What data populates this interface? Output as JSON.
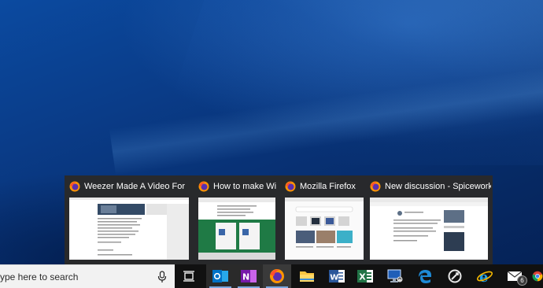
{
  "taskbar": {
    "search_placeholder": "ype here to search",
    "apps": [
      {
        "name": "task-view",
        "icon": "task-view-icon"
      },
      {
        "name": "outlook",
        "icon": "outlook-icon",
        "active": true
      },
      {
        "name": "onenote",
        "icon": "onenote-icon",
        "active": true
      },
      {
        "name": "firefox",
        "icon": "firefox-icon",
        "active": true,
        "hover": true
      },
      {
        "name": "file-explorer",
        "icon": "folder-icon"
      },
      {
        "name": "word",
        "icon": "word-icon"
      },
      {
        "name": "excel",
        "icon": "excel-icon"
      },
      {
        "name": "remote-desktop",
        "icon": "remote-desktop-icon"
      },
      {
        "name": "edge",
        "icon": "edge-icon"
      },
      {
        "name": "app-circle",
        "icon": "circular-arrow-icon"
      },
      {
        "name": "internet-explorer",
        "icon": "ie-icon"
      },
      {
        "name": "mail",
        "icon": "mail-icon",
        "badge": "6"
      },
      {
        "name": "chrome",
        "icon": "chrome-icon"
      }
    ]
  },
  "previews": [
    {
      "title": "Weezer Made A Video For Its 'A..."
    },
    {
      "title": "How to make Wi..."
    },
    {
      "title": "Mozilla Firefox"
    },
    {
      "title": "New discussion - Spiceworks - ..."
    }
  ],
  "colors": {
    "taskbar_bg": "#111111",
    "preview_bg": "#2a2a2a",
    "accent": "#7aa7e0",
    "word_blue": "#2b579a",
    "excel_green": "#217346",
    "onenote_purple": "#7719aa",
    "outlook_blue": "#0072c6"
  }
}
